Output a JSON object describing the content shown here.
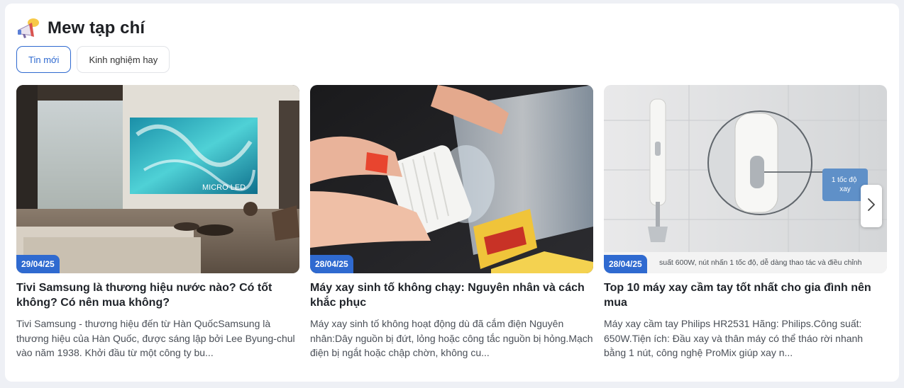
{
  "section": {
    "title": "Mew tạp chí",
    "icon": "megaphone-icon"
  },
  "tabs": [
    {
      "label": "Tin mới",
      "active": true
    },
    {
      "label": "Kinh nghiệm hay",
      "active": false
    }
  ],
  "articles": [
    {
      "date": "29/04/25",
      "title": "Tivi Samsung là thương hiệu nước nào? Có tốt không? Có nên mua không?",
      "desc": "Tivi Samsung - thương hiệu đến từ Hàn QuốcSamsung là thương hiệu của Hàn Quốc, được sáng lập bởi Lee Byung-chul vào năm 1938. Khởi đầu từ một công ty bu...",
      "image_text": "MICRO LED"
    },
    {
      "date": "28/04/25",
      "title": "Máy xay sinh tố không chạy: Nguyên nhân và cách khắc phục",
      "desc": "Máy xay sinh tố không hoạt động dù đã cắm điện Nguyên nhân:Dây nguồn bị đứt, lỏng hoặc công tắc nguồn bị hỏng.Mạch điện bị ngắt hoặc chập chờn, không cu..."
    },
    {
      "date": "28/04/25",
      "title": "Top 10 máy xay cầm tay tốt nhất cho gia đình nên mua",
      "desc": "Máy xay cầm tay Philips HR2531 Hãng: Philips.Công suất: 650W.Tiện ích: Đầu xay và thân máy có thể tháo rời nhanh bằng 1 nút, công nghệ ProMix giúp xay n...",
      "image_caption": "suất 600W, nút nhấn 1 tốc độ, dễ dàng thao tác và điều chỉnh",
      "image_callout": "1 tốc độ xay"
    }
  ],
  "colors": {
    "accent": "#2f6ad0",
    "background": "#eef0f5"
  },
  "next_icon": "chevron-right-icon"
}
